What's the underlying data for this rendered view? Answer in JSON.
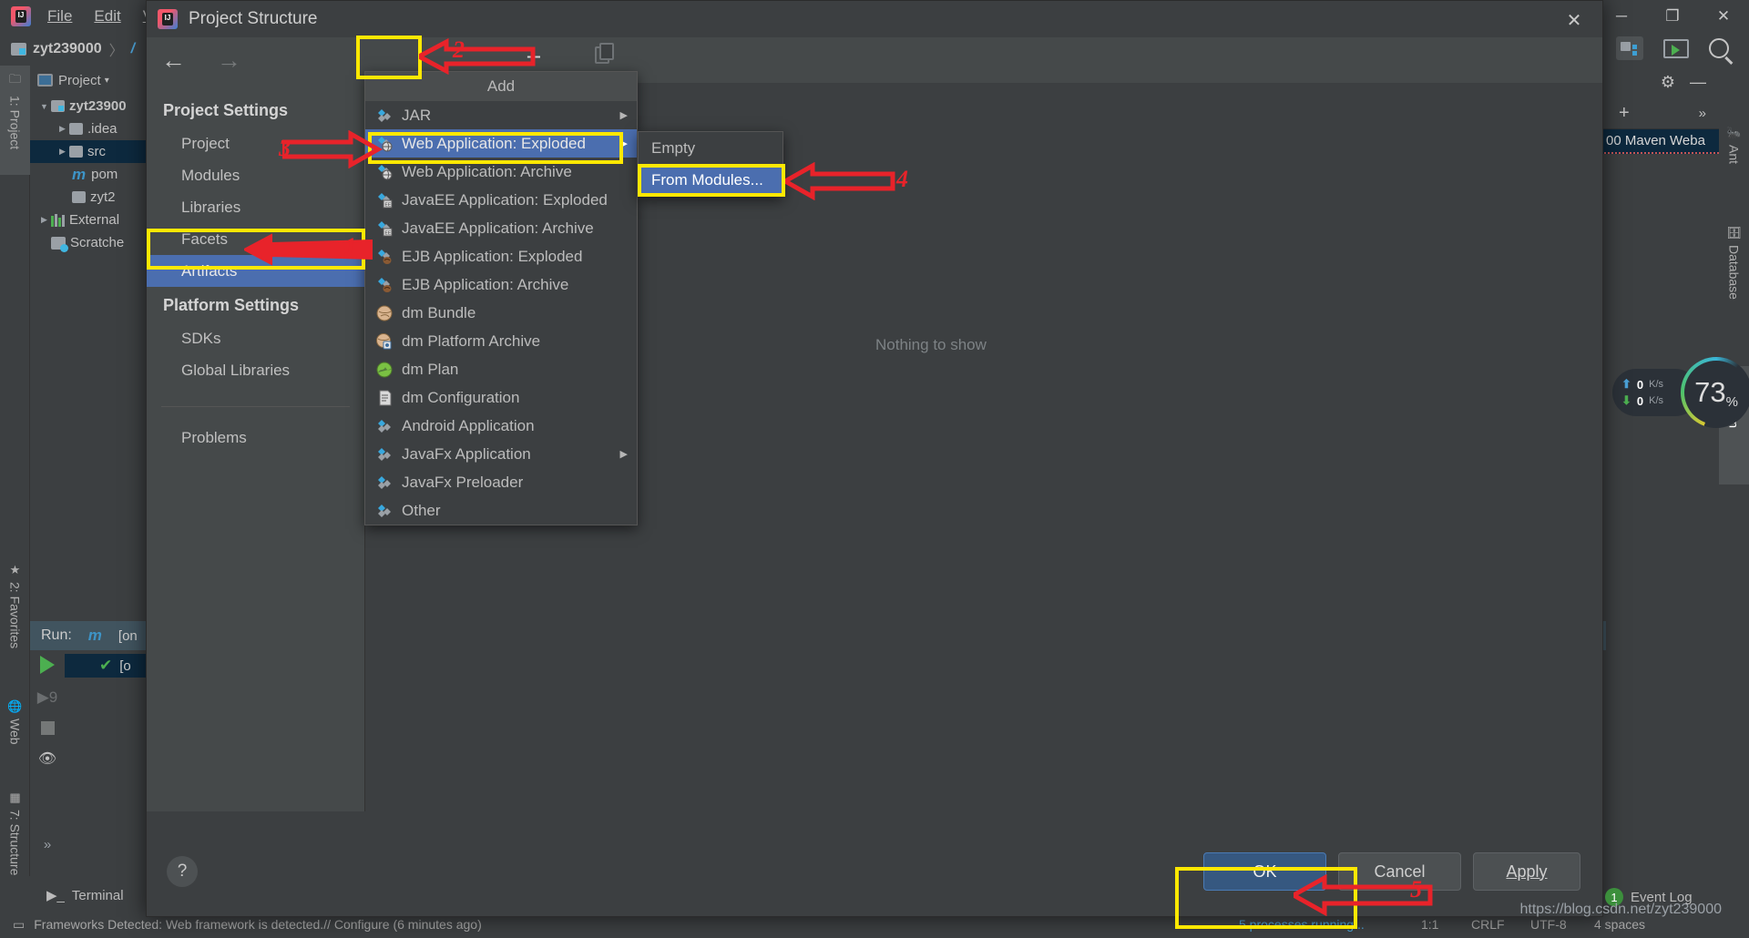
{
  "ide": {
    "menu_items": [
      "File",
      "Edit",
      "V"
    ],
    "breadcrumb": {
      "project": "zyt239000",
      "separator": "〉",
      "next": "/"
    },
    "window_controls": {
      "minimize": "─",
      "maximize": "❐",
      "close": "✕"
    },
    "left_tabs": [
      {
        "label": "1: Project",
        "icon": "folder-icon",
        "selected": true
      },
      {
        "label": "2: Favorites",
        "icon": "star-icon",
        "selected": false
      },
      {
        "label": "Web",
        "icon": "globe-icon",
        "selected": false
      },
      {
        "label": "7: Structure",
        "icon": "structure-icon",
        "selected": false
      }
    ],
    "project_panel": {
      "header": "Project",
      "header_caret": "▾",
      "tree": [
        {
          "label": "zyt23900",
          "indent": 0,
          "twisty": "▼",
          "icon": "module-folder-icon",
          "selected": false,
          "bold": true
        },
        {
          "label": ".idea",
          "indent": 1,
          "twisty": "▶",
          "icon": "folder-icon",
          "selected": false,
          "bold": false
        },
        {
          "label": "src",
          "indent": 1,
          "twisty": "▶",
          "icon": "folder-icon",
          "selected": true,
          "bold": false
        },
        {
          "label": "pom",
          "indent": 2,
          "twisty": "",
          "icon": "maven-icon",
          "selected": false,
          "bold": false
        },
        {
          "label": "zyt2",
          "indent": 2,
          "twisty": "",
          "icon": "file-icon",
          "selected": false,
          "bold": false
        },
        {
          "label": "External",
          "indent": 0,
          "twisty": "▶",
          "icon": "library-icon",
          "selected": false,
          "bold": false
        },
        {
          "label": "Scratche",
          "indent": 0,
          "twisty": "",
          "icon": "scratch-icon",
          "selected": false,
          "bold": false
        }
      ]
    },
    "run_panel": {
      "tab_label": "Run:",
      "config_icon": "maven-m-icon",
      "config_name": "[on",
      "tree_item": "[o",
      "buttons": [
        "run-icon",
        "rerun-icon",
        "stop-icon",
        "eye-icon",
        "more-icon"
      ]
    },
    "right_tabs": [
      {
        "label": "Ant",
        "icon": "ant-icon",
        "selected": false
      },
      {
        "label": "Database",
        "icon": "database-icon",
        "selected": false
      },
      {
        "label": "Maven",
        "icon": "maven-m-icon",
        "selected": true
      }
    ],
    "maven_panel": {
      "item": "00 Maven Weba",
      "toolbar_icons": [
        "gear-icon",
        "minimize-icon",
        "plus-icon",
        "chevrons-icon"
      ]
    },
    "top_right_icons": [
      "project-structure-icon",
      "run-config-icon",
      "search-icon"
    ],
    "network": {
      "upload": "0",
      "upload_unit": "K/s",
      "download": "0",
      "download_unit": "K/s"
    },
    "cpu": {
      "value": "73",
      "unit": "%"
    },
    "terminal_tab": "Terminal",
    "status_message": "Frameworks Detected: Web framework is detected.// Configure (6 minutes ago)",
    "status_right": [
      "5 processes running...",
      "1:1",
      "CRLF",
      "UTF-8",
      "4 spaces"
    ],
    "event_log": {
      "count": "1",
      "label": "Event Log"
    },
    "watermark": "https://blog.csdn.net/zyt239000"
  },
  "dialog": {
    "title": "Project Structure",
    "close": "✕",
    "nav_back": "←",
    "nav_forward": "→",
    "toolbar": {
      "add": "+",
      "copy_icon": "copy-icon"
    },
    "sections": [
      {
        "title": "Project Settings",
        "items": [
          {
            "label": "Project",
            "selected": false
          },
          {
            "label": "Modules",
            "selected": false
          },
          {
            "label": "Libraries",
            "selected": false
          },
          {
            "label": "Facets",
            "selected": false
          },
          {
            "label": "Artifacts",
            "selected": true
          }
        ]
      },
      {
        "title": "Platform Settings",
        "items": [
          {
            "label": "SDKs",
            "selected": false
          },
          {
            "label": "Global Libraries",
            "selected": false
          }
        ]
      },
      {
        "title": "",
        "items": [
          {
            "label": "Problems",
            "selected": false
          }
        ]
      }
    ],
    "empty_text": "Nothing to show",
    "help_button": "?",
    "buttons": {
      "ok": "OK",
      "cancel": "Cancel",
      "apply": "Apply"
    }
  },
  "add_menu": {
    "title": "Add",
    "items": [
      {
        "label": "JAR",
        "icon": "jar-icon",
        "has_submenu": true,
        "selected": false
      },
      {
        "label": "Web Application: Exploded",
        "icon": "web-exploded-icon",
        "has_submenu": true,
        "selected": true
      },
      {
        "label": "Web Application: Archive",
        "icon": "web-archive-icon",
        "has_submenu": false,
        "selected": false
      },
      {
        "label": "JavaEE Application: Exploded",
        "icon": "javaee-exploded-icon",
        "has_submenu": false,
        "selected": false
      },
      {
        "label": "JavaEE Application: Archive",
        "icon": "javaee-archive-icon",
        "has_submenu": false,
        "selected": false
      },
      {
        "label": "EJB Application: Exploded",
        "icon": "ejb-exploded-icon",
        "has_submenu": false,
        "selected": false
      },
      {
        "label": "EJB Application: Archive",
        "icon": "ejb-archive-icon",
        "has_submenu": false,
        "selected": false
      },
      {
        "label": "dm Bundle",
        "icon": "dm-bundle-icon",
        "has_submenu": false,
        "selected": false
      },
      {
        "label": "dm Platform Archive",
        "icon": "dm-platform-icon",
        "has_submenu": false,
        "selected": false
      },
      {
        "label": "dm Plan",
        "icon": "dm-plan-icon",
        "has_submenu": false,
        "selected": false
      },
      {
        "label": "dm Configuration",
        "icon": "dm-config-icon",
        "has_submenu": false,
        "selected": false
      },
      {
        "label": "Android Application",
        "icon": "android-icon",
        "has_submenu": false,
        "selected": false
      },
      {
        "label": "JavaFx Application",
        "icon": "javafx-icon",
        "has_submenu": true,
        "selected": false
      },
      {
        "label": "JavaFx Preloader",
        "icon": "javafx-preloader-icon",
        "has_submenu": false,
        "selected": false
      },
      {
        "label": "Other",
        "icon": "other-icon",
        "has_submenu": false,
        "selected": false
      }
    ]
  },
  "sub_menu": {
    "items": [
      {
        "label": "Empty",
        "selected": false
      },
      {
        "label": "From Modules...",
        "selected": true
      }
    ]
  },
  "annotations": {
    "numbers": [
      "1",
      "2",
      "3",
      "4",
      "5"
    ],
    "highlight_color": "#ffe800",
    "arrow_color": "#e8232a"
  }
}
